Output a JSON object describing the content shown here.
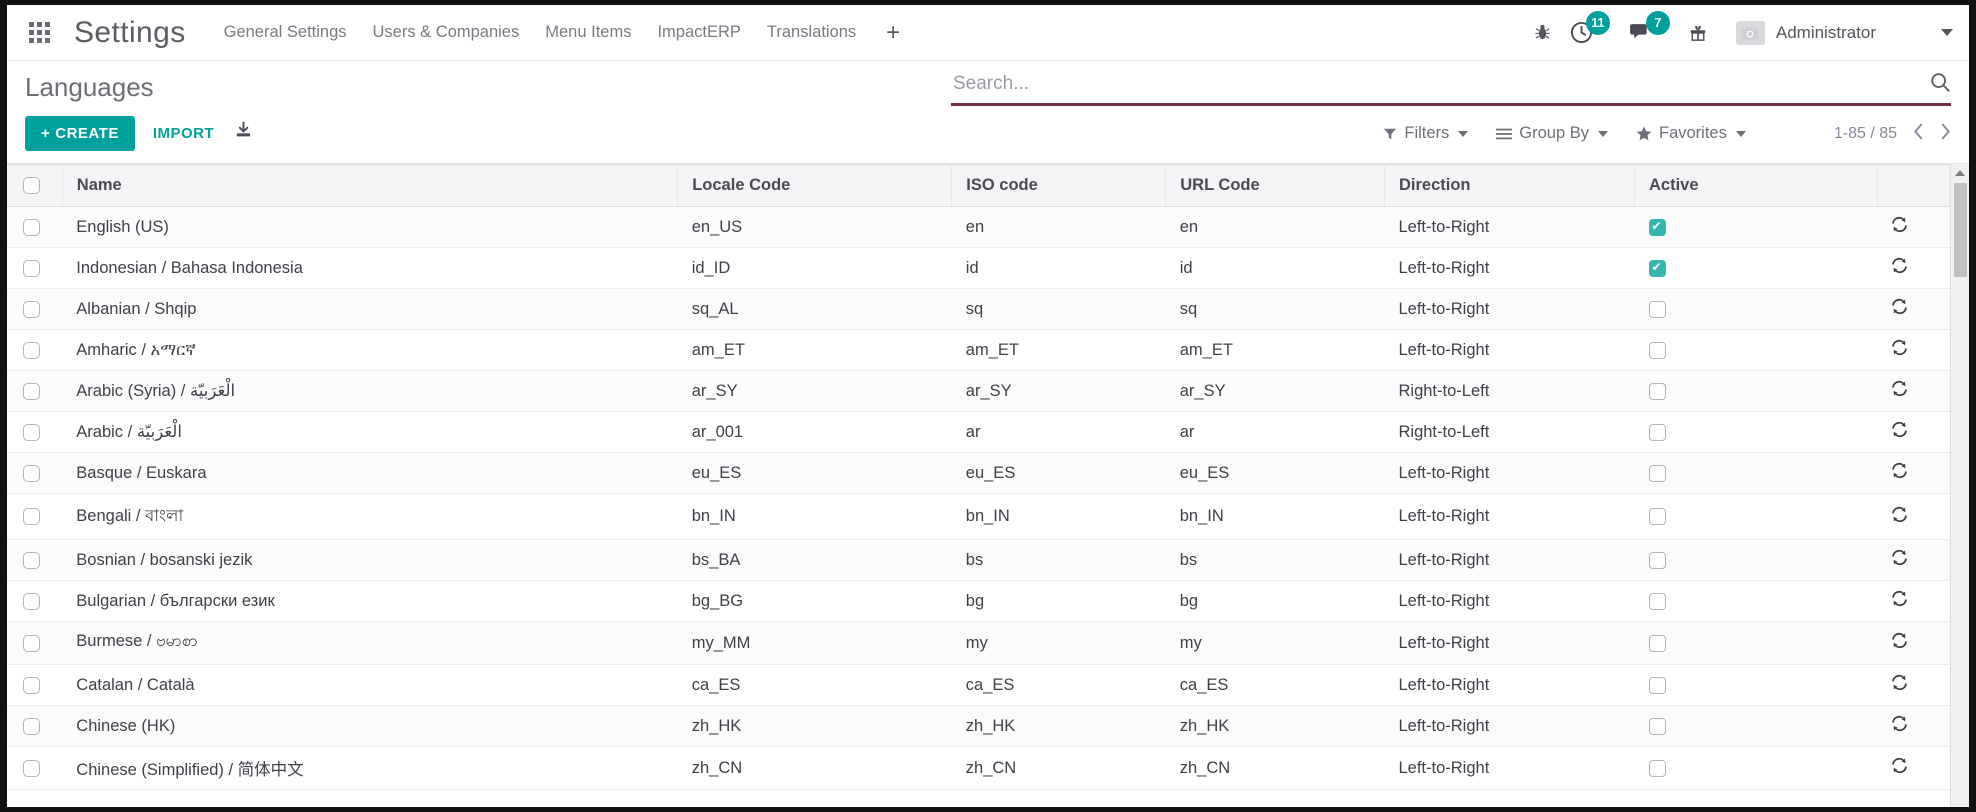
{
  "topbar": {
    "apps_icon": "apps-grid-icon",
    "brand": "Settings",
    "menu": [
      {
        "label": "General Settings"
      },
      {
        "label": "Users & Companies"
      },
      {
        "label": "Menu Items"
      },
      {
        "label": "ImpactERP"
      },
      {
        "label": "Translations"
      }
    ],
    "plus_label": "+",
    "debug_icon": "bug-icon",
    "activities": {
      "icon": "clock-icon",
      "count": "11"
    },
    "messages": {
      "icon": "chat-bubble-icon",
      "count": "7"
    },
    "gift_icon": "gift-icon",
    "user": {
      "avatar_icon": "camera-avatar-icon",
      "name": "Administrator"
    },
    "user_caret": "chevron-down-icon",
    "accent": "#00a09d"
  },
  "control_panel": {
    "title": "Languages",
    "create_label": "CREATE",
    "create_plus": "+",
    "import_label": "IMPORT",
    "download_icon": "download-icon",
    "search": {
      "placeholder": "Search...",
      "value": "",
      "icon": "search-icon",
      "underline_color": "#732c4a"
    },
    "filters": {
      "label": "Filters",
      "icon": "funnel-icon"
    },
    "group_by": {
      "label": "Group By",
      "icon": "list-lines-icon"
    },
    "favorites": {
      "label": "Favorites",
      "icon": "star-icon"
    },
    "pager": {
      "text": "1-85 / 85",
      "prev_icon": "chevron-left-icon",
      "next_icon": "chevron-right-icon"
    }
  },
  "table": {
    "select_all_label": "",
    "columns": [
      "Name",
      "Locale Code",
      "ISO code",
      "URL Code",
      "Direction",
      "Active"
    ],
    "rows": [
      {
        "name": "English (US)",
        "locale": "en_US",
        "iso": "en",
        "url": "en",
        "direction": "Left-to-Right",
        "active": true
      },
      {
        "name": "Indonesian / Bahasa Indonesia",
        "locale": "id_ID",
        "iso": "id",
        "url": "id",
        "direction": "Left-to-Right",
        "active": true
      },
      {
        "name": "Albanian / Shqip",
        "locale": "sq_AL",
        "iso": "sq",
        "url": "sq",
        "direction": "Left-to-Right",
        "active": false
      },
      {
        "name": "Amharic / አማርኛ",
        "locale": "am_ET",
        "iso": "am_ET",
        "url": "am_ET",
        "direction": "Left-to-Right",
        "active": false
      },
      {
        "name": "Arabic (Syria) / الْعَرَبيّة",
        "locale": "ar_SY",
        "iso": "ar_SY",
        "url": "ar_SY",
        "direction": "Right-to-Left",
        "active": false
      },
      {
        "name": "Arabic / الْعَرَبيّة",
        "locale": "ar_001",
        "iso": "ar",
        "url": "ar",
        "direction": "Right-to-Left",
        "active": false
      },
      {
        "name": "Basque / Euskara",
        "locale": "eu_ES",
        "iso": "eu_ES",
        "url": "eu_ES",
        "direction": "Left-to-Right",
        "active": false
      },
      {
        "name": "Bengali / বাংলা",
        "locale": "bn_IN",
        "iso": "bn_IN",
        "url": "bn_IN",
        "direction": "Left-to-Right",
        "active": false
      },
      {
        "name": "Bosnian / bosanski jezik",
        "locale": "bs_BA",
        "iso": "bs",
        "url": "bs",
        "direction": "Left-to-Right",
        "active": false
      },
      {
        "name": "Bulgarian / български език",
        "locale": "bg_BG",
        "iso": "bg",
        "url": "bg",
        "direction": "Left-to-Right",
        "active": false
      },
      {
        "name": "Burmese / ဗမာစာ",
        "locale": "my_MM",
        "iso": "my",
        "url": "my",
        "direction": "Left-to-Right",
        "active": false
      },
      {
        "name": "Catalan / Català",
        "locale": "ca_ES",
        "iso": "ca_ES",
        "url": "ca_ES",
        "direction": "Left-to-Right",
        "active": false
      },
      {
        "name": "Chinese (HK)",
        "locale": "zh_HK",
        "iso": "zh_HK",
        "url": "zh_HK",
        "direction": "Left-to-Right",
        "active": false
      },
      {
        "name": "Chinese (Simplified) / 简体中文",
        "locale": "zh_CN",
        "iso": "zh_CN",
        "url": "zh_CN",
        "direction": "Left-to-Right",
        "active": false
      }
    ],
    "row_action_icon": "sync-refresh-icon"
  },
  "scrollbar": {
    "up_arrow_icon": "scroll-up-arrow-icon",
    "thumb": "scroll-thumb"
  }
}
